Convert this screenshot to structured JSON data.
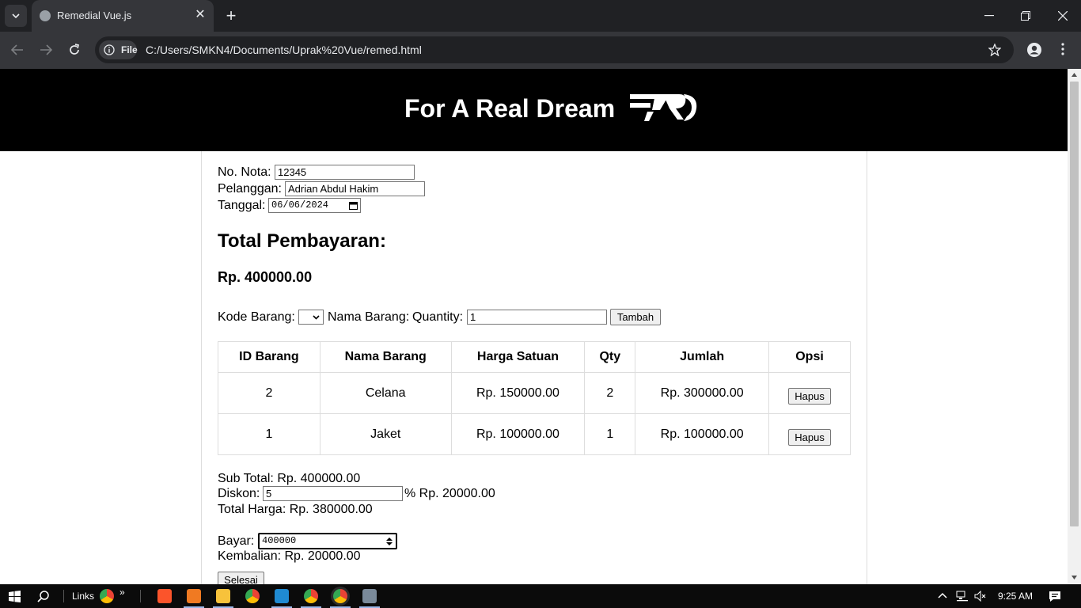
{
  "browser": {
    "tab_title": "Remedial Vue.js",
    "site_info_label": "File",
    "url": "C:/Users/SMKN4/Documents/Uprak%20Vue/remed.html"
  },
  "banner": {
    "title": "For A Real Dream",
    "logo_icon": "fard-logo-icon"
  },
  "form": {
    "nota_label": "No. Nota:",
    "nota_value": "12345",
    "pelanggan_label": "Pelanggan:",
    "pelanggan_value": "Adrian Abdul Hakim",
    "tanggal_label": "Tanggal:",
    "tanggal_value": "06/06/2024"
  },
  "total": {
    "heading": "Total Pembayaran:",
    "amount": "Rp. 400000.00"
  },
  "item_entry": {
    "kode_label": "Kode Barang:",
    "nama_label": "Nama Barang:",
    "qty_label": "Quantity:",
    "qty_value": "1",
    "add_button": "Tambah"
  },
  "table": {
    "headers": [
      "ID Barang",
      "Nama Barang",
      "Harga Satuan",
      "Qty",
      "Jumlah",
      "Opsi"
    ],
    "rows": [
      {
        "id": "2",
        "nama": "Celana",
        "harga": "Rp. 150000.00",
        "qty": "2",
        "jumlah": "Rp. 300000.00",
        "action": "Hapus"
      },
      {
        "id": "1",
        "nama": "Jaket",
        "harga": "Rp. 100000.00",
        "qty": "1",
        "jumlah": "Rp. 100000.00",
        "action": "Hapus"
      }
    ]
  },
  "summary": {
    "subtotal": "Sub Total: Rp. 400000.00",
    "diskon_label": "Diskon:",
    "diskon_value": "5",
    "diskon_amount": "% Rp. 20000.00",
    "total_harga": "Total Harga: Rp. 380000.00",
    "bayar_label": "Bayar:",
    "bayar_value": "400000",
    "kembalian": "Kembalian: Rp. 20000.00",
    "finish_button": "Selesai"
  },
  "taskbar": {
    "links_label": "Links",
    "clock": "9:25 AM"
  }
}
